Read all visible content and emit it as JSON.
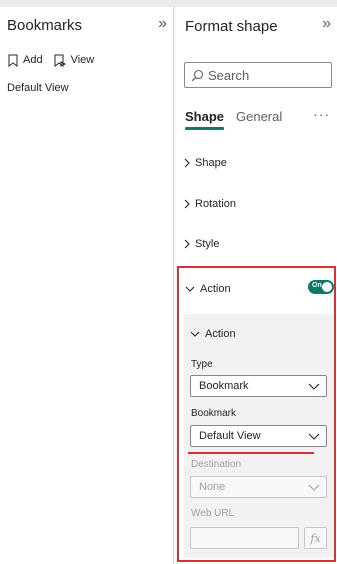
{
  "bookmarks": {
    "title": "Bookmarks",
    "collapse_glyph": "»",
    "toolbar": {
      "add_label": "Add",
      "view_label": "View"
    },
    "items": [
      {
        "label": "Default View"
      }
    ]
  },
  "format_shape": {
    "title": "Format shape",
    "collapse_glyph": "»",
    "search": {
      "placeholder": "Search",
      "value": ""
    },
    "tabs": [
      {
        "label": "Shape",
        "active": true
      },
      {
        "label": "General",
        "active": false
      }
    ],
    "more_glyph": "···",
    "sections": [
      {
        "label": "Shape",
        "expanded": false
      },
      {
        "label": "Rotation",
        "expanded": false
      },
      {
        "label": "Style",
        "expanded": false
      },
      {
        "label": "Action",
        "expanded": true,
        "toggle": "On"
      }
    ],
    "action_card": {
      "title": "Action",
      "type_label": "Type",
      "type_value": "Bookmark",
      "bookmark_label": "Bookmark",
      "bookmark_value": "Default View",
      "destination_label": "Destination",
      "destination_value": "None",
      "web_url_label": "Web URL",
      "web_url_value": "",
      "fx_label": "fx"
    }
  },
  "colors": {
    "accent": "#117865",
    "highlight": "#d13438",
    "text": "#252423",
    "disabled": "#a19f9d"
  },
  "icons": [
    "bookmark-add-icon",
    "bookmark-view-icon",
    "search-icon",
    "chevron-right-icon",
    "chevron-down-icon",
    "double-chevron-icon",
    "fx-icon"
  ]
}
